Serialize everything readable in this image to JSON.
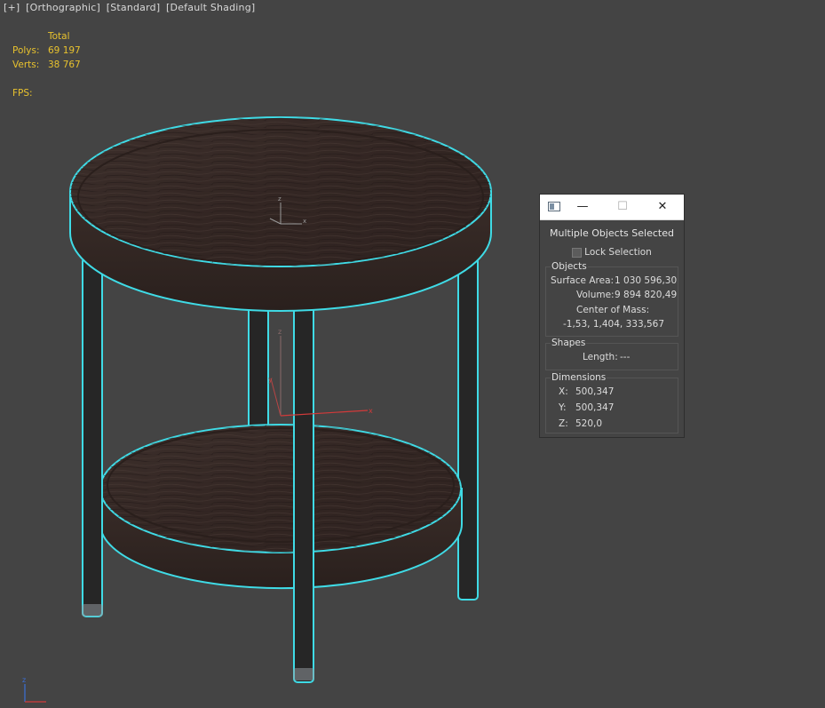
{
  "viewport": {
    "labels": [
      "[+]",
      "[Orthographic]",
      "[Standard]",
      "[Default Shading]"
    ]
  },
  "stats": {
    "header": "Total",
    "polys_label": "Polys:",
    "polys_value": "69 197",
    "verts_label": "Verts:",
    "verts_value": "38 767",
    "fps_label": "FPS:"
  },
  "gizmo_axes": {
    "x": "x",
    "y": "y",
    "z": "z"
  },
  "panel": {
    "title": "Multiple Objects Selected",
    "lock_label": "Lock Selection",
    "objects": {
      "label": "Objects",
      "surface_area_label": "Surface Area:",
      "surface_area_value": "1 030 596,30",
      "volume_label": "Volume:",
      "volume_value": "9 894 820,49",
      "com_label": "Center of Mass:",
      "com_value": "-1,53, 1,404, 333,567"
    },
    "shapes": {
      "label": "Shapes",
      "length_label": "Length:",
      "length_value": "---"
    },
    "dimensions": {
      "label": "Dimensions",
      "x_label": "X:",
      "x_value": "500,347",
      "y_label": "Y:",
      "y_value": "500,347",
      "z_label": "Z:",
      "z_value": "520,0"
    }
  },
  "colors": {
    "background": "#444444",
    "selection_outline": "#3fdbe6",
    "stats_text": "#e8c22e",
    "wood": "#3a2c28"
  }
}
